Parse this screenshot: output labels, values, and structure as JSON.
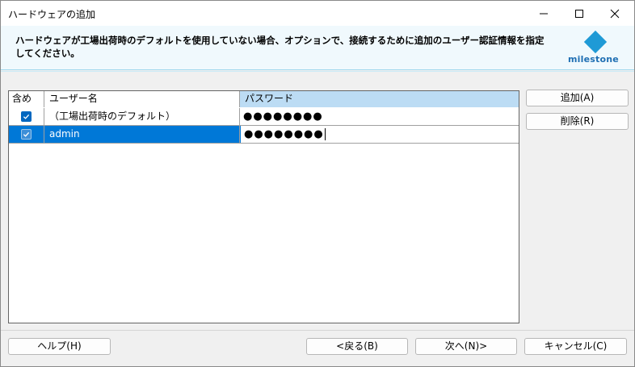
{
  "window": {
    "title": "ハードウェアの追加"
  },
  "header": {
    "instruction": "ハードウェアが工場出荷時のデフォルトを使用していない場合、オプションで、接続するために追加のユーザー認証情報を指定してください。",
    "logo_text": "milestone",
    "logo_color": "#1f9ad6"
  },
  "grid": {
    "columns": [
      "含め",
      "ユーザー名",
      "パスワード"
    ],
    "rows": [
      {
        "included": true,
        "username": "（工場出荷時のデフォルト）",
        "password": "●●●●●●●●"
      },
      {
        "included": true,
        "username": "admin",
        "password": "●●●●●●●●"
      }
    ],
    "selected_color": "#0078d7"
  },
  "side_buttons": {
    "add": "追加(A)",
    "remove": "削除(R)"
  },
  "footer": {
    "help": "ヘルプ(H)",
    "back": "<戻る(B)",
    "next": "次へ(N)>",
    "cancel": "キャンセル(C)"
  }
}
